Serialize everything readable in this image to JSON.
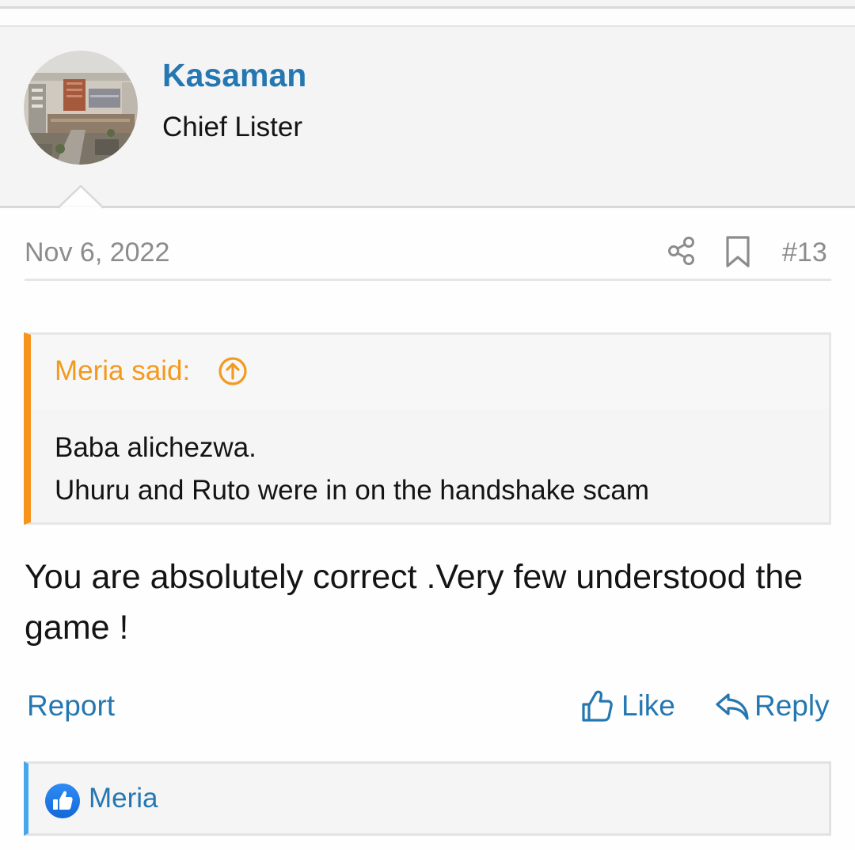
{
  "post": {
    "author": {
      "name": "Kasaman",
      "title": "Chief Lister",
      "avatar_icon": "avatar-city-photo"
    },
    "date": "Nov 6, 2022",
    "number": "#13",
    "icons": {
      "share": "share-icon",
      "bookmark": "bookmark-icon"
    },
    "quote": {
      "author_label": "Meria said:",
      "jump_icon": "arrow-up-circle-icon",
      "lines": [
        "Baba alichezwa.",
        "Uhuru and Ruto were in on the handshake scam"
      ]
    },
    "message": "You are absolutely correct .Very few understood the game !",
    "actions": {
      "report": "Report",
      "like": "Like",
      "reply": "Reply"
    },
    "reactions": {
      "icon": "like-reaction-icon",
      "users": "Meria"
    }
  },
  "colors": {
    "link": "#2577b1",
    "quote_accent": "#f7941d",
    "reaction_accent": "#47a7eb",
    "muted_text": "#8c8c8c"
  }
}
